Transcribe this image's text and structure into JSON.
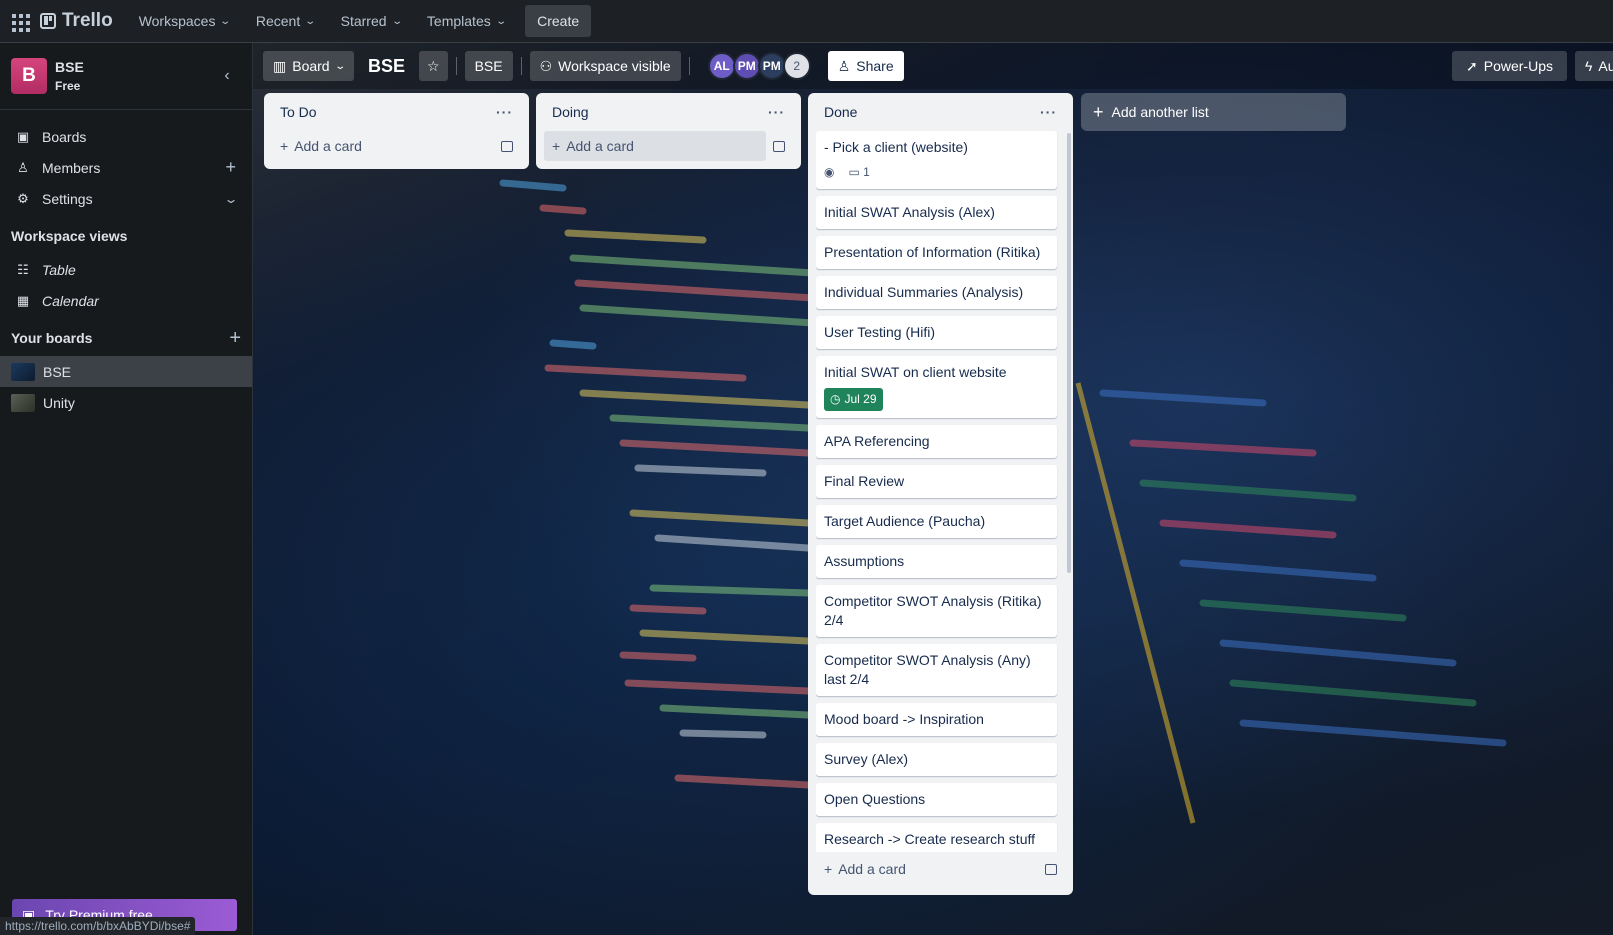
{
  "topnav": {
    "brand": "Trello",
    "menus": [
      "Workspaces",
      "Recent",
      "Starred",
      "Templates"
    ],
    "create_label": "Create"
  },
  "sidebar": {
    "workspace_initial": "B",
    "workspace_name": "BSE",
    "workspace_plan": "Free",
    "items": [
      {
        "label": "Boards",
        "icon": "board-icon"
      },
      {
        "label": "Members",
        "icon": "person-icon"
      },
      {
        "label": "Settings",
        "icon": "gear-icon"
      }
    ],
    "views_heading": "Workspace views",
    "views": [
      {
        "label": "Table",
        "icon": "table-icon"
      },
      {
        "label": "Calendar",
        "icon": "calendar-icon"
      }
    ],
    "boards_heading": "Your boards",
    "boards": [
      {
        "label": "BSE",
        "active": true
      },
      {
        "label": "Unity",
        "active": false
      }
    ],
    "premium_label": "Try Premium free",
    "status_url": "https://trello.com/b/bxAbBYDi/bse#"
  },
  "board": {
    "view_label": "Board",
    "title": "BSE",
    "workspace_tag": "BSE",
    "visibility_label": "Workspace visible",
    "members": [
      {
        "initials": "AL",
        "color": "#6e5dc6"
      },
      {
        "initials": "PM",
        "color": "#5e4db2"
      },
      {
        "initials": "PM",
        "color": "#2c3e5d"
      }
    ],
    "member_count": "2",
    "share_label": "Share",
    "powerups_label": "Power-Ups",
    "automation_label": "Au",
    "add_list_label": "Add another list"
  },
  "lists": [
    {
      "title": "To Do",
      "add_card": "Add a card",
      "cards": []
    },
    {
      "title": "Doing",
      "add_card": "Add a card",
      "cards": []
    },
    {
      "title": "Done",
      "add_card": "Add a card",
      "cards": [
        {
          "title": "- Pick a client (website)",
          "comments": "1"
        },
        {
          "title": "Initial SWAT Analysis (Alex)"
        },
        {
          "title": "Presentation of Information (Ritika)"
        },
        {
          "title": "Individual Summaries (Analysis)"
        },
        {
          "title": "User Testing (Hifi)"
        },
        {
          "title": "Initial SWAT on client website",
          "due": "Jul 29"
        },
        {
          "title": "APA Referencing"
        },
        {
          "title": "Final Review"
        },
        {
          "title": "Target Audience (Paucha)"
        },
        {
          "title": "Assumptions"
        },
        {
          "title": "Competitor SWOT Analysis (Ritika) 2/4"
        },
        {
          "title": "Competitor SWOT Analysis (Any) last 2/4"
        },
        {
          "title": "Mood board -> Inspiration"
        },
        {
          "title": "Survey (Alex)"
        },
        {
          "title": "Open Questions"
        },
        {
          "title": "Research -> Create research stuff (in document) (ALL)"
        }
      ]
    }
  ]
}
